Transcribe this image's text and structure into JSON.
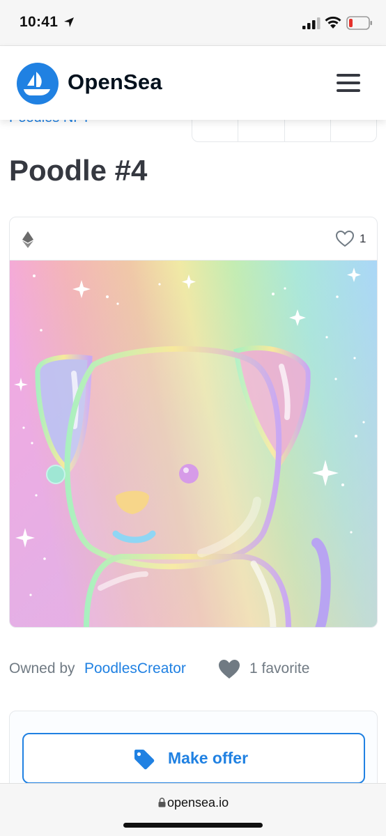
{
  "status_bar": {
    "time": "10:41"
  },
  "header": {
    "brand": "OpenSea",
    "icons": [
      "opensea-logo-icon",
      "hamburger-menu-icon"
    ]
  },
  "item": {
    "collection": "Poodles NFT",
    "title": "Poodle #4",
    "chain_icon": "ethereum-icon",
    "favorite_count": "1",
    "owned_by_label": "Owned by",
    "owner": "PoodlesCreator",
    "favorites_label": "1 favorite"
  },
  "actions": {
    "make_offer_label": "Make offer"
  },
  "browser": {
    "url": "opensea.io"
  },
  "colors": {
    "accent": "#2081e2",
    "text": "#353840",
    "muted": "#707a83"
  }
}
